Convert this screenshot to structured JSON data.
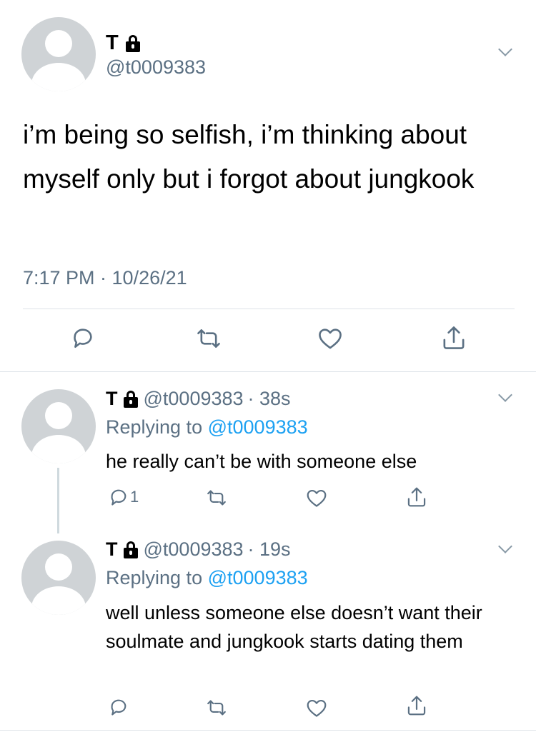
{
  "main_tweet": {
    "display_name": "T",
    "handle": "@t0009383",
    "text": "i’m being so selfish, i’m thinking about myself only but i forgot about jungkook",
    "timestamp": "7:17 PM · 10/26/21",
    "actions": [
      "reply-icon",
      "retweet-icon",
      "like-icon",
      "share-icon"
    ]
  },
  "replies": [
    {
      "display_name": "T",
      "handle": "@t0009383",
      "age": "· 38s",
      "replying_prefix": "Replying to",
      "replying_to": "@t0009383",
      "text": "he really can’t be with someone else",
      "reply_count": "1"
    },
    {
      "display_name": "T",
      "handle": "@t0009383",
      "age": "· 19s",
      "replying_prefix": "Replying to",
      "replying_to": "@t0009383",
      "text": "well unless someone else doesn’t want their soulmate and jungkook starts dating them",
      "reply_count": ""
    }
  ],
  "colors": {
    "secondary_text": "#5b7083",
    "link": "#1da1f2",
    "divider": "#dde3e8",
    "avatar": "#cfd3d6"
  }
}
